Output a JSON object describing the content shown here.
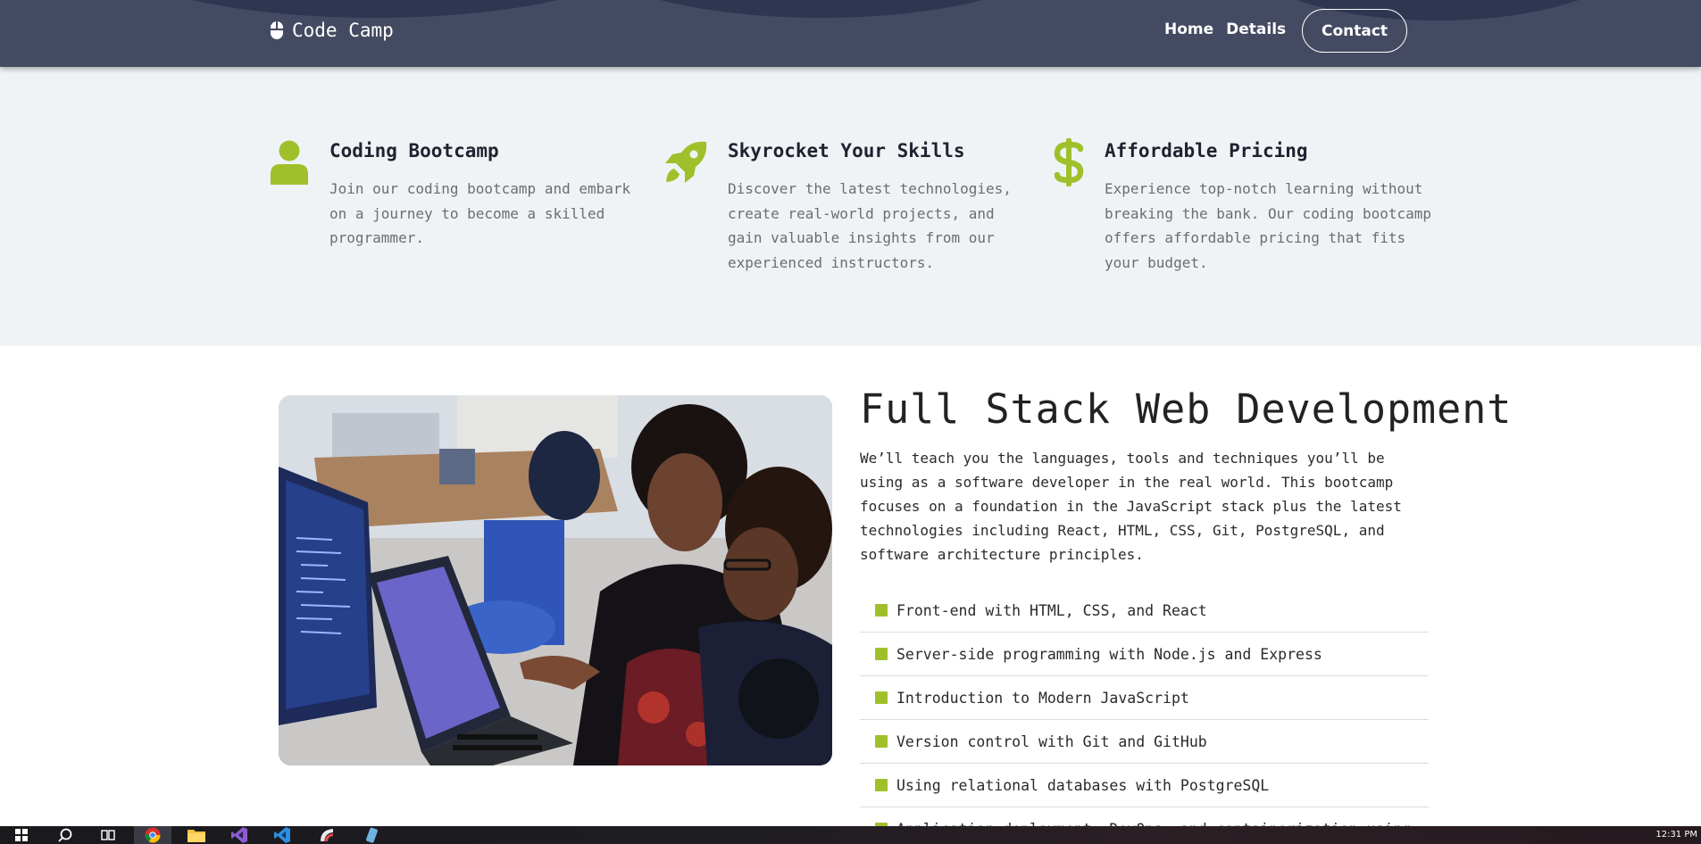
{
  "navbar": {
    "brand": "Code Camp",
    "links": [
      "Home",
      "Details"
    ],
    "contact_label": "Contact"
  },
  "features": [
    {
      "icon": "person-icon",
      "title": "Coding Bootcamp",
      "text": "Join our coding bootcamp and embark on a journey to become a skilled programmer."
    },
    {
      "icon": "rocket-icon",
      "title": "Skyrocket Your Skills",
      "text": "Discover the latest technologies, create real-world projects, and gain valuable insights from our experienced instructors."
    },
    {
      "icon": "dollar-icon",
      "title": "Affordable Pricing",
      "text": "Experience top-notch learning without breaking the bank. Our coding bootcamp offers affordable pricing that fits your budget."
    }
  ],
  "course": {
    "title": "Full Stack Web Development",
    "description": "We’ll teach you the languages, tools and techniques you’ll be using as a software developer in the real world. This bootcamp focuses on a foundation in the JavaScript stack plus the latest technologies including React, HTML, CSS, Git, PostgreSQL, and software architecture principles.",
    "topics": [
      "Front-end with HTML, CSS, and React",
      "Server-side programming with Node.js and Express",
      "Introduction to Modern JavaScript",
      "Version control with Git and GitHub",
      "Using relational databases with PostgreSQL",
      "Application deployment, DevOps, and containerization using"
    ]
  },
  "colors": {
    "accent": "#a0c02b",
    "navbar": "#444a61",
    "features_bg": "#f0f3f6"
  },
  "taskbar": {
    "apps": [
      "windows-start-icon",
      "search-icon",
      "task-view-icon",
      "chrome-icon",
      "file-explorer-icon",
      "visual-studio-icon",
      "vscode-icon",
      "app-icon",
      "app-icon"
    ],
    "clock": "12:31 PM"
  }
}
